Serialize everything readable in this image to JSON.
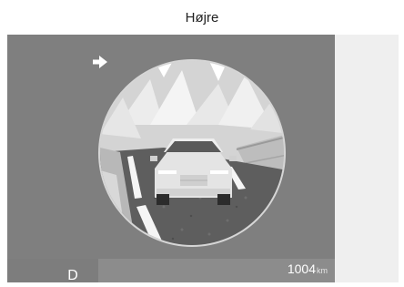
{
  "header": {
    "title": "Højre"
  },
  "cluster": {
    "gear": "D",
    "odometer": "1004",
    "odometer_unit": "km",
    "turn_signal_icon": "right-turn-arrow-icon"
  },
  "colors": {
    "screen_bg": "#7f7f7f",
    "right_panel_bg": "#efefef"
  }
}
